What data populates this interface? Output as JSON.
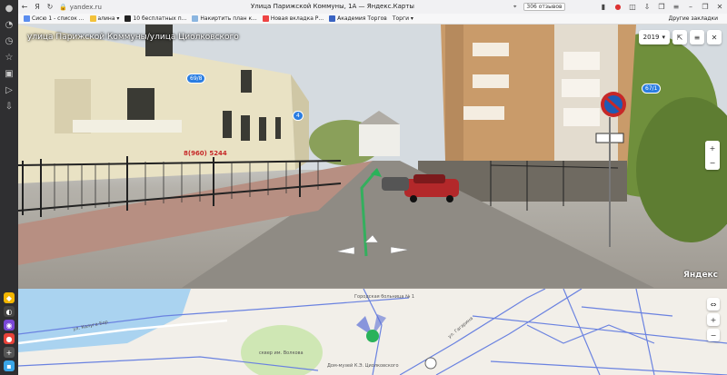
{
  "browser": {
    "url": "yandex.ru",
    "title": "Улица Парижской Коммуны, 1А — Яндекс.Карты",
    "reviews_label": "306 отзывов"
  },
  "bookmarks": [
    {
      "label": "Сисю 1 - список ...",
      "color": "#5b8def"
    },
    {
      "label": "алина ▾",
      "color": "#f3c23a"
    },
    {
      "label": "10 бесплатных п...",
      "color": "#222222"
    },
    {
      "label": "Накиртить план к...",
      "color": "#8bb6e0"
    },
    {
      "label": "Новая вкладка Р...",
      "color": "#e44"
    },
    {
      "label": "Академия Торгов",
      "color": "#3a63c2"
    },
    {
      "label": "Торги ▾",
      "color": "#999999"
    }
  ],
  "bookmarks_other": "Другие закладки",
  "panorama": {
    "street_label": "улица Парижской Коммуны/улица Циолковского",
    "year": "2019",
    "badges": [
      "69/8",
      "4",
      "67/1"
    ],
    "shop_phone": "8(960) 5244",
    "watermark": "Яндекс"
  },
  "minimap": {
    "labels": [
      "ул. Калуга-Бор",
      "сквер им. Волкова",
      "Дом-музей К.Э. Циолковского",
      "Городская больница № 1",
      "ул. Гагарина"
    ]
  },
  "colors": {
    "accent": "#2a7de1",
    "marker": "#2ab25a"
  }
}
